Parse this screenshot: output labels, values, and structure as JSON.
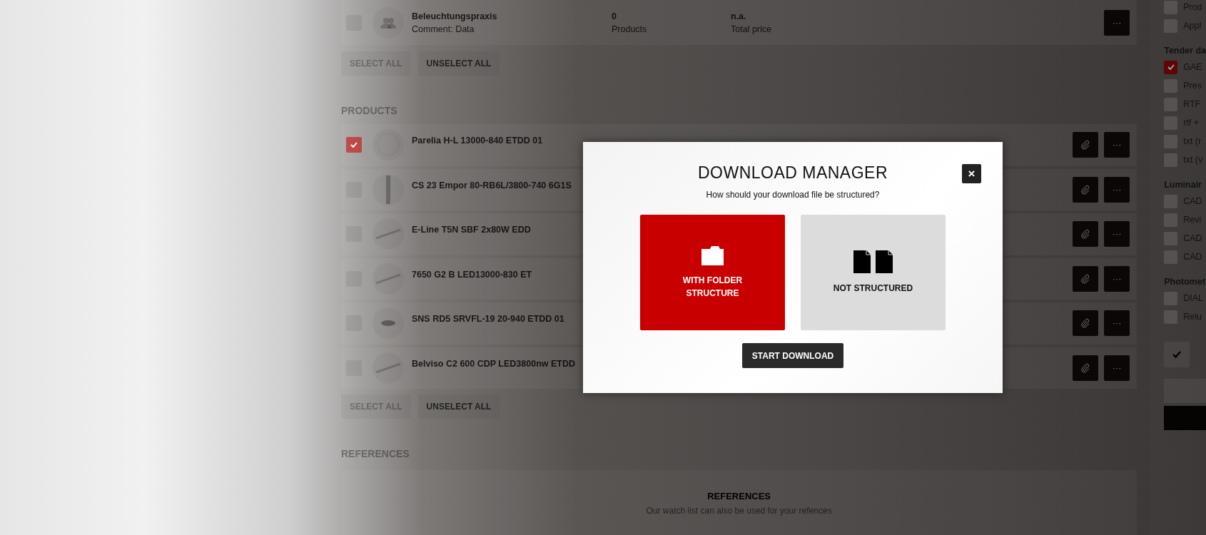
{
  "watchlist": {
    "name": "Beleuchtungspraxis",
    "comment": "Comment: Data",
    "checked": false,
    "count": "0",
    "count_label": "Products",
    "price": "n.a.",
    "price_label": "Total price",
    "more": "···"
  },
  "watchlist_actions": [
    "SELECT ALL",
    "UNSELECT ALL"
  ],
  "products_heading": "PRODUCTS",
  "products": [
    {
      "name": "Parelia H-L 13000-840 ETDD 01",
      "checked": true,
      "kind": "round"
    },
    {
      "name": "CS 23 Empor 80-RB6L/3800-740 6G1S",
      "checked": false,
      "kind": "tube"
    },
    {
      "name": "E-Line T5N SBF 2x80W EDD",
      "checked": false,
      "kind": "bar"
    },
    {
      "name": "7650 G2 B LED13000-830 ET",
      "checked": false,
      "kind": "bar"
    },
    {
      "name": "SNS RD5 SRVFL-19 20-940 ETDD 01",
      "checked": false,
      "kind": "downlight"
    },
    {
      "name": "Belviso C2 600 CDP LED3800nw ETDD",
      "checked": false,
      "kind": "bar"
    }
  ],
  "product_more": "···",
  "products_actions": [
    "SELECT ALL",
    "UNSELECT ALL"
  ],
  "references_heading": "REFERENCES",
  "references": {
    "title": "REFERENCES",
    "text": "Our watch list can also be used for your refences"
  },
  "sidebar": [
    {
      "kind": "check",
      "label": "Prod",
      "checked": false
    },
    {
      "kind": "check",
      "label": "Appl",
      "checked": false
    },
    {
      "kind": "heading",
      "label": "Tender da"
    },
    {
      "kind": "check",
      "label": "GAE",
      "checked": true
    },
    {
      "kind": "check",
      "label": "Pres",
      "checked": false
    },
    {
      "kind": "check",
      "label": "RTF",
      "checked": false
    },
    {
      "kind": "check",
      "label": "rtf +",
      "checked": false
    },
    {
      "kind": "check",
      "label": "txt (r",
      "checked": false
    },
    {
      "kind": "check",
      "label": "txt (v",
      "checked": false
    },
    {
      "kind": "heading",
      "label": "Luminair"
    },
    {
      "kind": "check",
      "label": "CAD",
      "checked": false
    },
    {
      "kind": "check",
      "label": "Revi",
      "checked": false
    },
    {
      "kind": "check",
      "label": "CAD",
      "checked": false
    },
    {
      "kind": "check",
      "label": "CAD",
      "checked": false
    },
    {
      "kind": "heading",
      "label": "Photomet"
    },
    {
      "kind": "check",
      "label": "DIAL",
      "checked": false
    },
    {
      "kind": "check",
      "label": "Relu",
      "checked": false
    }
  ],
  "modal": {
    "title": "DOWNLOAD MANAGER",
    "close": "×",
    "question": "How should your download file be structured?",
    "options": [
      {
        "kind": "folder",
        "label": "WITH FOLDER STRUCTURE",
        "selected": true
      },
      {
        "kind": "files",
        "label": "NOT STRUCTURED",
        "selected": false
      }
    ],
    "button": "START DOWNLOAD"
  }
}
